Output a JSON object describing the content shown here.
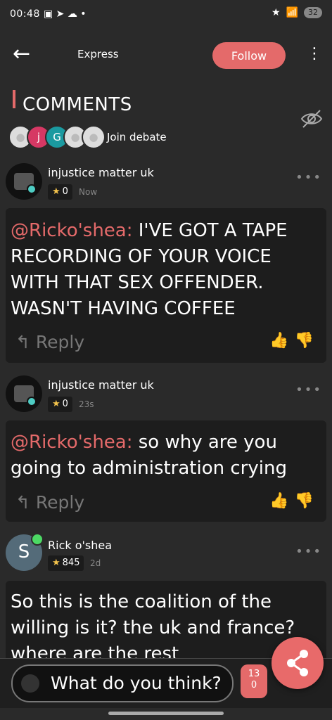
{
  "status": {
    "time": "00:48",
    "battery": "32"
  },
  "header": {
    "brand": "Express",
    "follow_label": "Follow"
  },
  "section": {
    "title": "COMMENTS",
    "join": "Join debate",
    "avatars": [
      "",
      "j",
      "G",
      "",
      ""
    ]
  },
  "comments": [
    {
      "user": "injustice matter uk",
      "score": "0",
      "time": "Now",
      "mention": "@Ricko'shea:",
      "text": " I'VE GOT A TAPE RECORDING OF YOUR VOICE WITH THAT SEX OFFENDER. WASN'T HAVING COFFEE",
      "reply": "Reply"
    },
    {
      "user": "injustice matter uk",
      "score": "0",
      "time": "23s",
      "mention": "@Ricko'shea:",
      "text": " so why are you going to administration crying",
      "reply": "Reply"
    },
    {
      "user": "Rick o'shea",
      "initial": "S",
      "score": "845",
      "time": "2d",
      "text": "So this is the coalition of the willing is it? the uk and france? where are the rest"
    }
  ],
  "bottom": {
    "placeholder": "What do you think?",
    "count_top": "13",
    "count_bottom": "0"
  },
  "colors": {
    "accent": "#e46a6a",
    "background": "#2a2a2a",
    "card": "#1d1d1d"
  }
}
